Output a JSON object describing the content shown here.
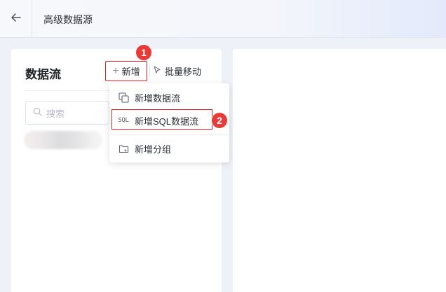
{
  "header": {
    "back_icon": "arrow-left-icon",
    "title": "高级数据源"
  },
  "left_panel": {
    "title": "数据流",
    "add_button": {
      "icon": "plus-icon",
      "label": "新增"
    },
    "batch_move_button": {
      "icon": "cursor-arrow-icon",
      "label": "批量移动"
    },
    "search": {
      "icon": "search-icon",
      "placeholder": "搜索"
    }
  },
  "dropdown": {
    "items": [
      {
        "icon": "copy-squares-icon",
        "label": "新增数据流"
      },
      {
        "icon": "sql-icon",
        "icon_text": "SQL",
        "label": "新增SQL数据流"
      },
      {
        "icon": "folder-icon",
        "label": "新增分组"
      }
    ]
  },
  "annotations": {
    "badge_1": "1",
    "badge_2": "2",
    "color": "#e83a36"
  }
}
